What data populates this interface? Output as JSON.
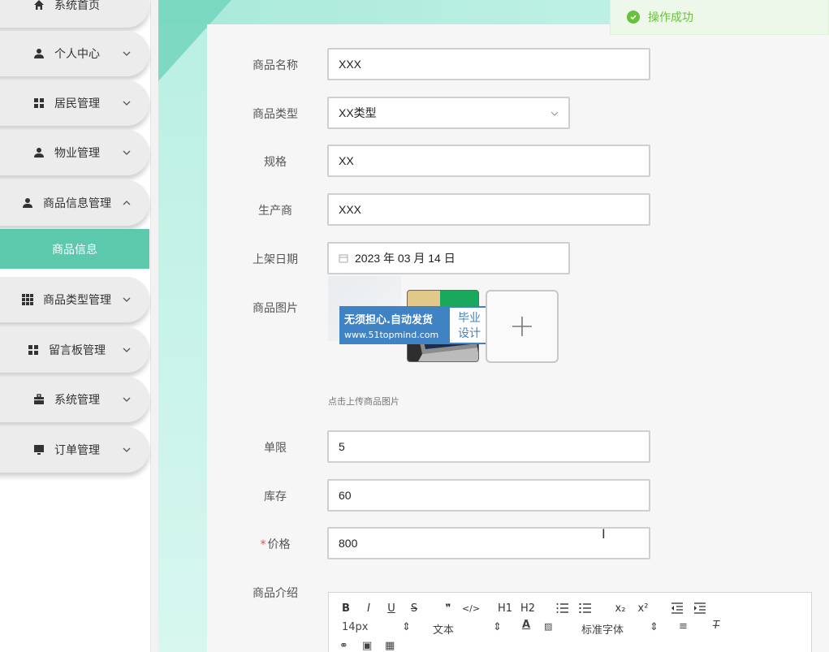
{
  "sidebar": {
    "items": [
      {
        "label": "系统首页",
        "icon": "home-icon"
      },
      {
        "label": "个人中心",
        "icon": "user-icon"
      },
      {
        "label": "居民管理",
        "icon": "grid-icon"
      },
      {
        "label": "物业管理",
        "icon": "user-icon"
      },
      {
        "label": "商品信息管理",
        "icon": "user-icon"
      },
      {
        "label": "商品类型管理",
        "icon": "grid9-icon"
      },
      {
        "label": "留言板管理",
        "icon": "grid-icon"
      },
      {
        "label": "系统管理",
        "icon": "briefcase-icon"
      },
      {
        "label": "订单管理",
        "icon": "monitor-icon"
      }
    ],
    "active_sub": "商品信息"
  },
  "toast": {
    "message": "操作成功",
    "color": "#67c23a"
  },
  "form": {
    "name_label": "商品名称",
    "name_value": "XXX",
    "type_label": "商品类型",
    "type_value": "XX类型",
    "spec_label": "规格",
    "spec_value": "XX",
    "maker_label": "生产商",
    "maker_value": "XXX",
    "date_label": "上架日期",
    "date_value": "2023 年 03 月 14 日",
    "image_label": "商品图片",
    "image_hint": "点击上传商品图片",
    "limit_label": "单限",
    "limit_value": "5",
    "stock_label": "库存",
    "stock_value": "60",
    "price_required": "*",
    "price_label": "价格",
    "price_value": "800",
    "intro_label": "商品介绍"
  },
  "watermark": {
    "line1": "无须担心.自动发货",
    "line2": "www.51topmind.com",
    "right": "毕业设计"
  },
  "editor": {
    "buttons": [
      "B",
      "I",
      "U",
      "S",
      "❞",
      "</>",
      "H1",
      "H2",
      "x₂",
      "x²"
    ],
    "font_size": "14px",
    "text_style": "文本",
    "font_family": "标准字体"
  },
  "colors": {
    "accent": "#5cc8ac",
    "teal_light": "#c8f4ea",
    "required": "#e84c4c"
  }
}
